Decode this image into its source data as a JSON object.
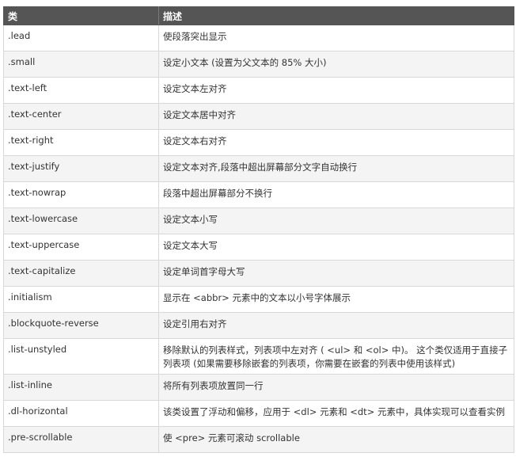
{
  "table": {
    "headers": [
      "类",
      "描述"
    ],
    "rows": [
      [
        ".lead",
        "使段落突出显示"
      ],
      [
        ".small",
        "设定小文本 (设置为父文本的 85% 大小)"
      ],
      [
        ".text-left",
        "设定文本左对齐"
      ],
      [
        ".text-center",
        "设定文本居中对齐"
      ],
      [
        ".text-right",
        "设定文本右对齐"
      ],
      [
        ".text-justify",
        "设定文本对齐,段落中超出屏幕部分文字自动换行"
      ],
      [
        ".text-nowrap",
        "段落中超出屏幕部分不换行"
      ],
      [
        ".text-lowercase",
        "设定文本小写"
      ],
      [
        ".text-uppercase",
        "设定文本大写"
      ],
      [
        ".text-capitalize",
        "设定单词首字母大写"
      ],
      [
        ".initialism",
        "显示在 <abbr> 元素中的文本以小号字体展示"
      ],
      [
        ".blockquote-reverse",
        "设定引用右对齐"
      ],
      [
        ".list-unstyled",
        "移除默认的列表样式，列表项中左对齐 ( <ul> 和 <ol> 中)。 这个类仅适用于直接子列表项 (如果需要移除嵌套的列表项，你需要在嵌套的列表中使用该样式)"
      ],
      [
        ".list-inline",
        "将所有列表项放置同一行"
      ],
      [
        ".dl-horizontal",
        "该类设置了浮动和偏移，应用于 <dl> 元素和 <dt> 元素中，具体实现可以查看实例"
      ],
      [
        ".pre-scrollable",
        "使 <pre> 元素可滚动 scrollable"
      ]
    ]
  },
  "colors": {
    "header_bg": "#555555",
    "header_text": "#ffffff",
    "row_alt_bg": "#f4f4f4",
    "border": "#d8d8d8",
    "text": "#333333"
  }
}
